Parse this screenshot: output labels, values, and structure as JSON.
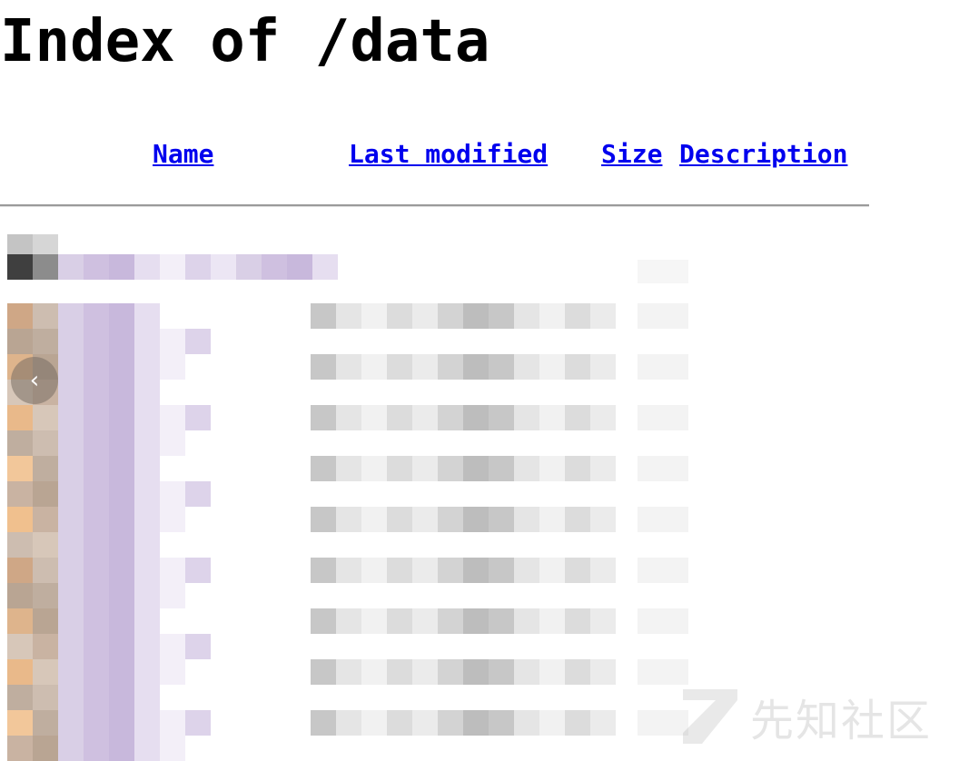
{
  "page": {
    "title": "Index of /data"
  },
  "columns": [
    {
      "label": "Name"
    },
    {
      "label": "Last modified"
    },
    {
      "label": "Size"
    },
    {
      "label": "Description"
    }
  ],
  "listing": {
    "pixelated": true,
    "row_count": 15
  },
  "watermark": {
    "text": "先知社区"
  },
  "icons": {
    "nav": "chevron-left-icon"
  },
  "colors": {
    "link": "#0000ee",
    "text": "#000000",
    "rule": "#9a9a9a"
  }
}
